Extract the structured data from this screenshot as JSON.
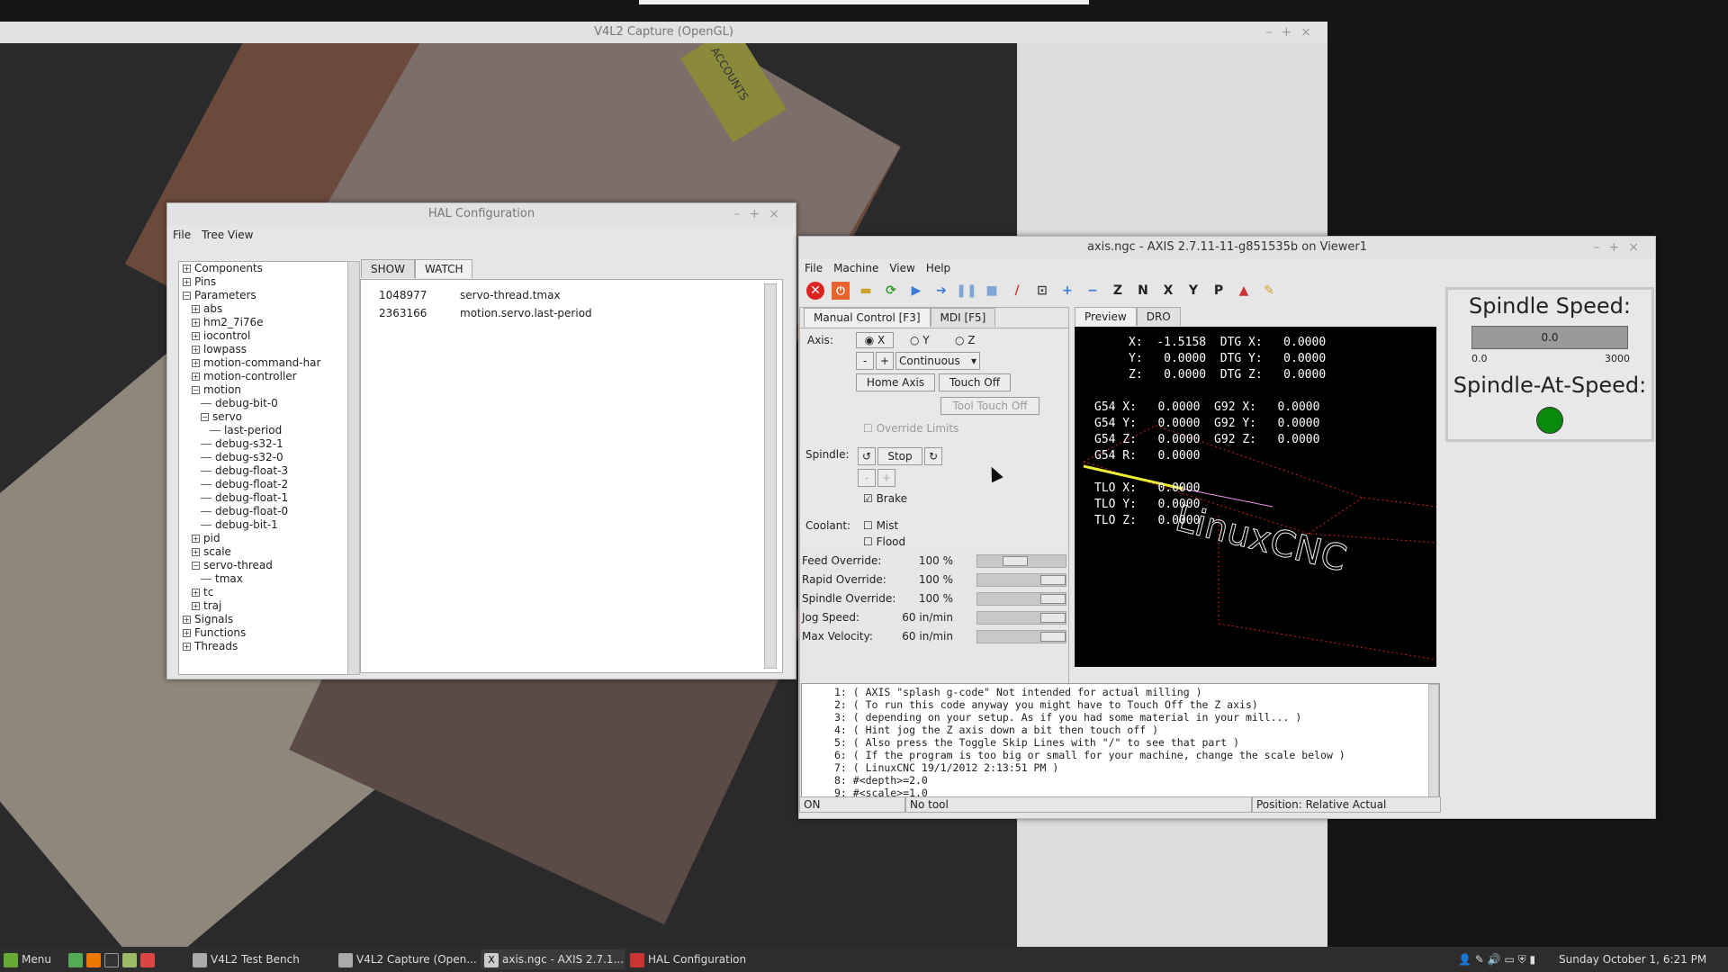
{
  "v4l2_window": {
    "title": "V4L2 Capture (OpenGL)",
    "video_text": "ACCOUNTS"
  },
  "hal": {
    "title": "HAL Configuration",
    "menu": [
      "File",
      "Tree View"
    ],
    "tree": [
      {
        "l": "Components",
        "d": 0,
        "x": true
      },
      {
        "l": "Pins",
        "d": 0,
        "x": true
      },
      {
        "l": "Parameters",
        "d": 0,
        "x": false
      },
      {
        "l": "abs",
        "d": 1,
        "x": true
      },
      {
        "l": "hm2_7i76e",
        "d": 1,
        "x": true
      },
      {
        "l": "iocontrol",
        "d": 1,
        "x": true
      },
      {
        "l": "lowpass",
        "d": 1,
        "x": true
      },
      {
        "l": "motion-command-har",
        "d": 1,
        "x": true
      },
      {
        "l": "motion-controller",
        "d": 1,
        "x": true
      },
      {
        "l": "motion",
        "d": 1,
        "x": false
      },
      {
        "l": "debug-bit-0",
        "d": 2
      },
      {
        "l": "servo",
        "d": 2,
        "x": false
      },
      {
        "l": "last-period",
        "d": 3
      },
      {
        "l": "debug-s32-1",
        "d": 2
      },
      {
        "l": "debug-s32-0",
        "d": 2
      },
      {
        "l": "debug-float-3",
        "d": 2
      },
      {
        "l": "debug-float-2",
        "d": 2
      },
      {
        "l": "debug-float-1",
        "d": 2
      },
      {
        "l": "debug-float-0",
        "d": 2
      },
      {
        "l": "debug-bit-1",
        "d": 2
      },
      {
        "l": "pid",
        "d": 1,
        "x": true
      },
      {
        "l": "scale",
        "d": 1,
        "x": true
      },
      {
        "l": "servo-thread",
        "d": 1,
        "x": false
      },
      {
        "l": "tmax",
        "d": 2
      },
      {
        "l": "tc",
        "d": 1,
        "x": true
      },
      {
        "l": "traj",
        "d": 1,
        "x": true
      },
      {
        "l": "Signals",
        "d": 0,
        "x": true
      },
      {
        "l": "Functions",
        "d": 0,
        "x": true
      },
      {
        "l": "Threads",
        "d": 0,
        "x": true
      }
    ],
    "tabs": [
      "SHOW",
      "WATCH"
    ],
    "watch": [
      {
        "value": "1048977",
        "name": "servo-thread.tmax"
      },
      {
        "value": "2363166",
        "name": "motion.servo.last-period"
      }
    ]
  },
  "axis": {
    "title": "axis.ngc - AXIS 2.7.11-11-g851535b on Viewer1",
    "menu": [
      "File",
      "Machine",
      "View",
      "Help"
    ],
    "tabs": [
      "Manual Control [F3]",
      "MDI [F5]"
    ],
    "preview_tabs": [
      "Preview",
      "DRO"
    ],
    "axis_label": "Axis:",
    "axes": [
      "X",
      "Y",
      "Z"
    ],
    "jog_minus": "-",
    "jog_plus": "+",
    "jog_mode": "Continuous",
    "home_axis": "Home Axis",
    "touch_off": "Touch Off",
    "tool_touch_off": "Tool Touch Off",
    "override_limits": "Override Limits",
    "spindle_label": "Spindle:",
    "spindle_stop": "Stop",
    "spindle_minus": "-",
    "spindle_plus": "+",
    "brake": "Brake",
    "coolant_label": "Coolant:",
    "mist": "Mist",
    "flood": "Flood",
    "overrides": [
      {
        "label": "Feed Override:",
        "value": "100 %",
        "level": 0.4
      },
      {
        "label": "Rapid Override:",
        "value": "100 %",
        "level": 1.0
      },
      {
        "label": "Spindle Override:",
        "value": "100 %",
        "level": 1.0
      },
      {
        "label": "Jog Speed:",
        "value": "60 in/min",
        "level": 1.0
      },
      {
        "label": "Max Velocity:",
        "value": "60 in/min",
        "level": 1.0
      }
    ],
    "dro": [
      "X:  -1.5158  DTG X:   0.0000",
      "Y:   0.0000  DTG Y:   0.0000",
      "Z:   0.0000  DTG Z:   0.0000",
      "",
      "G54 X:   0.0000  G92 X:   0.0000",
      "G54 Y:   0.0000  G92 Y:   0.0000",
      "G54 Z:   0.0000  G92 Z:   0.0000",
      "G54 R:   0.0000",
      "",
      "TLO X:   0.0000",
      "TLO Y:   0.0000",
      "TLO Z:   0.0000"
    ],
    "preview_logo": "LinuxCNC",
    "code": [
      "1: ( AXIS \"splash g-code\" Not intended for actual milling )",
      "2: ( To run this code anyway you might have to Touch Off the Z axis)",
      "3: ( depending on your setup. As if you had some material in your mill... )",
      "4: ( Hint jog the Z axis down a bit then touch off )",
      "5: ( Also press the Toggle Skip Lines with \"/\" to see that part )",
      "6: ( If the program is too big or small for your machine, change the scale below )",
      "7: ( LinuxCNC 19/1/2012 2:13:51 PM )",
      "8: #<depth>=2.0",
      "9: #<scale>=1.0"
    ],
    "status_on": "ON",
    "status_tool": "No tool",
    "status_position": "Position: Relative Actual",
    "spindle_speed_label": "Spindle Speed:",
    "spindle_speed_value": "0.0",
    "spindle_min": "0.0",
    "spindle_max": "3000",
    "spindle_at_speed_label": "Spindle-At-Speed:",
    "led_color": "#0a8a0a"
  },
  "taskbar": {
    "menu": "Menu",
    "items": [
      "V4L2 Test Bench",
      "V4L2 Capture (Open...",
      "axis.ngc - AXIS 2.7.1...",
      "HAL Configuration"
    ],
    "clock": "Sunday October 1,  6:21 PM"
  }
}
